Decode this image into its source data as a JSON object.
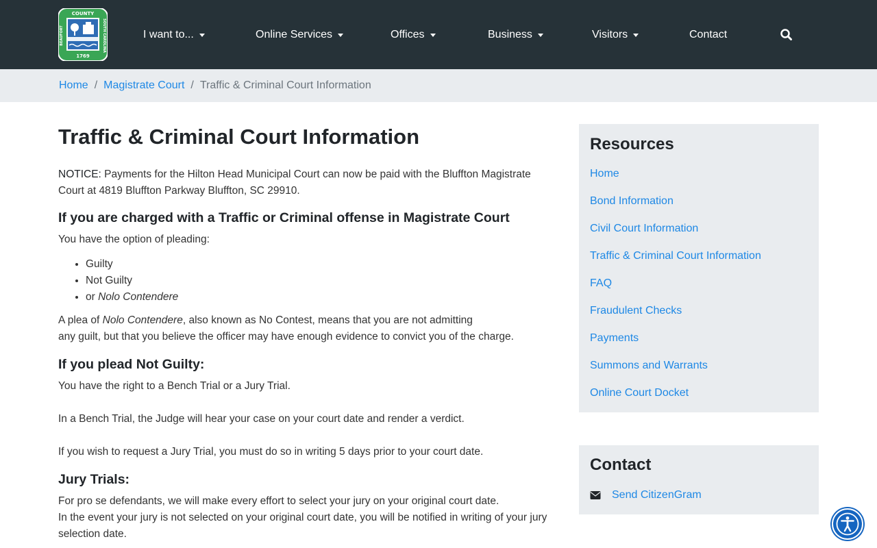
{
  "colors": {
    "navbar_bg": "#263238",
    "link": "#1e88e5",
    "breadcrumb_bg": "#e9ecef",
    "sidebar_bg": "#e9ecef",
    "accessibility_bg": "#1565c0"
  },
  "logo": {
    "top_text": "COUNTY",
    "left_text": "BEAUFORT",
    "right_text": "SOUTH CAROLINA",
    "year": "1769"
  },
  "nav": {
    "items": [
      {
        "label": "I want to...",
        "dropdown": true
      },
      {
        "label": "Online Services",
        "dropdown": true
      },
      {
        "label": "Offices",
        "dropdown": true
      },
      {
        "label": "Business",
        "dropdown": true
      },
      {
        "label": "Visitors",
        "dropdown": true
      },
      {
        "label": "Contact",
        "dropdown": false
      }
    ],
    "search_icon": "search-icon"
  },
  "breadcrumb": {
    "home": "Home",
    "parent": "Magistrate Court",
    "current": "Traffic & Criminal Court Information",
    "separator": "/"
  },
  "main": {
    "title": "Traffic & Criminal Court Information",
    "notice_label": "NOTICE:",
    "notice_text": " Payments for the Hilton Head Municipal Court can now be paid with the Bluffton Magistrate Court at 4819 Bluffton Parkway Bluffton, SC 29910.",
    "charged_heading": "If you are charged with a Traffic or Criminal offense in Magistrate Court",
    "option_text": "You have the option of pleading:",
    "pleas": {
      "guilty": "Guilty",
      "not_guilty": "Not Guilty",
      "nolo_prefix": "or ",
      "nolo": "Nolo Contendere"
    },
    "nolo_para": {
      "prefix": "A plea of ",
      "term": "Nolo Contendere",
      "line1_rest": ", also known as No Contest, means that you are not admitting",
      "line2": "any guilt, but that you believe the officer may have enough evidence to convict you of the charge."
    },
    "not_guilty_heading": "If you plead Not Guilty:",
    "right_text": "You have the right to a Bench Trial or a Jury Trial.",
    "bench_text": "In a Bench Trial, the Judge will hear your case on your court date and render a verdict.",
    "jury_request_text": "If you wish to request a Jury Trial, you must do so in writing 5 days prior to your court date.",
    "jury_heading": "Jury Trials:",
    "prose_line1": "For pro se defendants, we will make every effort to select your jury on your original court date.",
    "prose_line2": "In the event your jury is not selected on your original court date, you will be notified in writing of your jury selection date."
  },
  "sidebar": {
    "resources_title": "Resources",
    "links": [
      "Home",
      "Bond Information",
      "Civil Court Information",
      "Traffic & Criminal Court Information",
      "FAQ",
      "Fraudulent Checks",
      "Payments",
      "Summons and Warrants",
      "Online Court Docket"
    ],
    "contact_title": "Contact",
    "contact_link": "Send CitizenGram",
    "contact_icon": "envelope-icon"
  },
  "accessibility": {
    "icon": "accessibility-icon"
  }
}
